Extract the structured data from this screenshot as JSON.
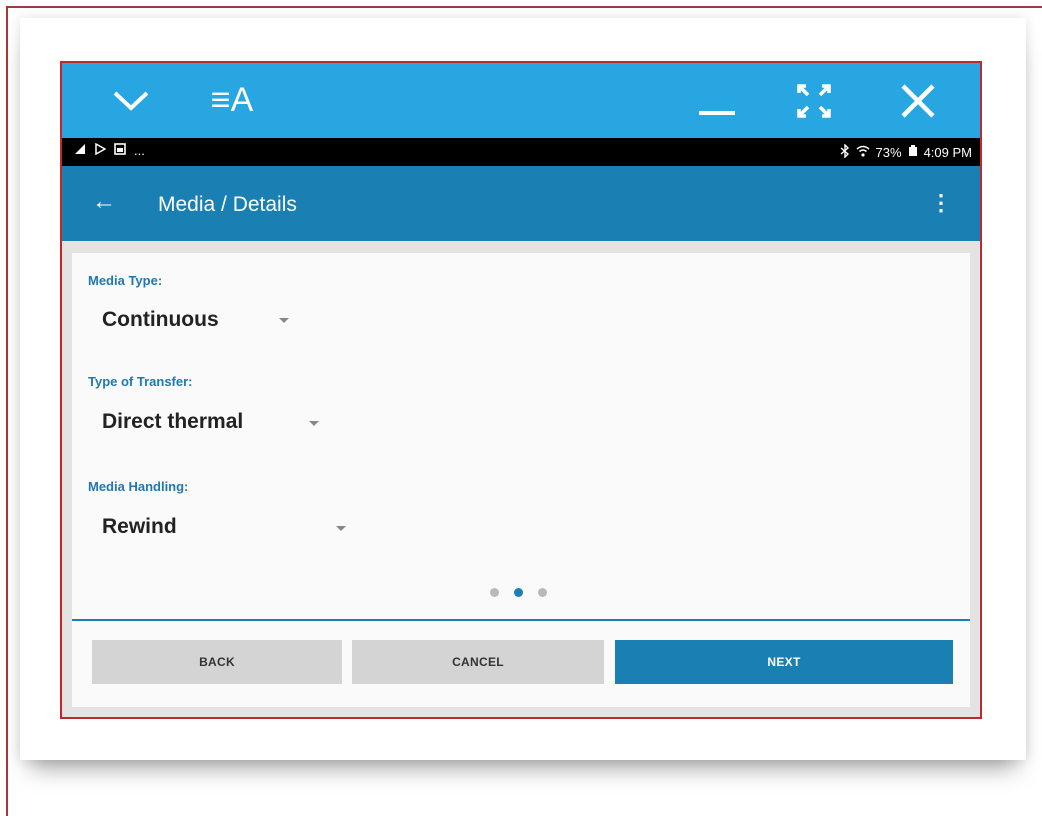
{
  "title_bar": {
    "logo_text": "≡A",
    "icons": [
      "chevron-down-icon",
      "logo-icon",
      "minimize-icon",
      "fullscreen-icon",
      "close-icon"
    ]
  },
  "status_bar": {
    "left_text": "...",
    "battery": "73%",
    "time": "4:09 PM"
  },
  "app_bar": {
    "title": "Media / Details",
    "back": "←",
    "overflow": "⋮"
  },
  "form": {
    "media_type_label": "Media Type:",
    "media_type_value": "Continuous",
    "transfer_label": "Type of Transfer:",
    "transfer_value": "Direct thermal",
    "handling_label": "Media Handling:",
    "handling_value": "Rewind"
  },
  "pager": {
    "count": 3,
    "active": 2
  },
  "buttons": {
    "back": "BACK",
    "cancel": "CANCEL",
    "next": "NEXT"
  },
  "colors": {
    "title_bar": "#27a6e1",
    "app_bar": "#1a7fb2",
    "accent": "#1f78b4",
    "frame": "#c0282e"
  }
}
